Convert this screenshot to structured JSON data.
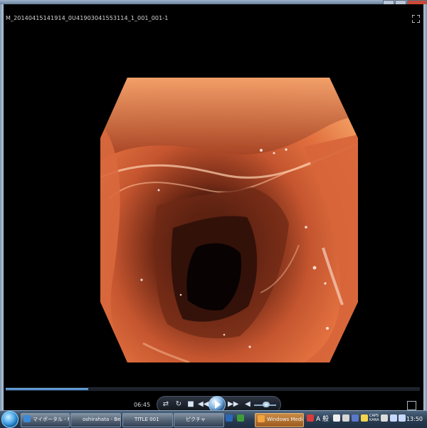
{
  "window": {
    "title": "M_20140415141914_0U41903041553114_1_001_001-1"
  },
  "player": {
    "current_time": "06:45",
    "progress_fraction": 0.2,
    "volume_fraction": 0.55,
    "controls": [
      "shuffle-icon",
      "repeat-icon",
      "stop-icon",
      "previous-icon",
      "play-icon",
      "next-icon",
      "volume-icon"
    ]
  },
  "taskbar": {
    "items": [
      {
        "label": "マイポータル - NI...",
        "icon_color": "#3a8ad9"
      },
      {
        "label": "oshirahata - Bec...",
        "icon_color": "#6c7fa3"
      },
      {
        "label": "TITLE 001",
        "icon_color": "#e8c95a"
      },
      {
        "label": "ピクチャ",
        "icon_color": "#6c93c7"
      },
      {
        "label": "Windows Media ...",
        "icon_color": "#f2a43d"
      }
    ],
    "tray_caps": "CAPS",
    "tray_kana": "KANA",
    "tray_lang": "A 般",
    "clock": "13:50"
  },
  "colors": {
    "accent": "#3877b6",
    "active_task": "#c98b44"
  }
}
